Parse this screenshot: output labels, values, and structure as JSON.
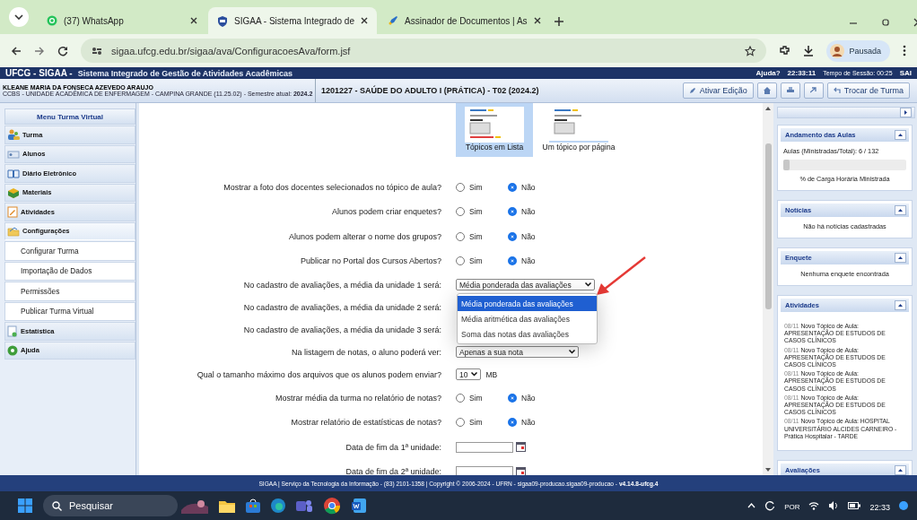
{
  "browser": {
    "tabs": [
      {
        "title": "(37) WhatsApp",
        "selected": false
      },
      {
        "title": "SIGAA - Sistema Integrado de",
        "selected": true
      },
      {
        "title": "Assinador de Documentos | As",
        "selected": false
      }
    ],
    "url": "sigaa.ufcg.edu.br/sigaa/ava/ConfiguracoesAva/form.jsf",
    "profile": "Pausada"
  },
  "app_bar": {
    "title": "UFCG - SIGAA -",
    "subtitle": "Sistema Integrado de Gestão de Atividades Acadêmicas",
    "help": "Ajuda?",
    "clock": "22:33:11",
    "session": "Tempo de Sessão: 00:25",
    "logout": "SAI"
  },
  "header": {
    "user": "KLEANE MARIA DA FONSECA AZEVEDO ARAUJO",
    "unit": "CCBS - UNIDADE ACADÊMICA DE ENFERMAGEM - CAMPINA GRANDE (11.25.02) - Semestre atual: **2024.2**",
    "course": "1201227 - SAÚDE DO ADULTO I (PRÁTICA) - T02 (2024.2)",
    "edit_button": "Ativar Edição",
    "switch_button": "Trocar de Turma"
  },
  "sidebar": {
    "title": "Menu Turma Virtual",
    "items": [
      {
        "label": "Turma"
      },
      {
        "label": "Alunos"
      },
      {
        "label": "Diário Eletrônico"
      },
      {
        "label": "Materiais"
      },
      {
        "label": "Atividades"
      },
      {
        "label": "Configurações",
        "expanded": true,
        "children": [
          {
            "label": "Configurar Turma"
          },
          {
            "label": "Importação de Dados"
          },
          {
            "label": "Permissões"
          },
          {
            "label": "Publicar Turma Virtual"
          }
        ]
      },
      {
        "label": "Estatística"
      },
      {
        "label": "Ajuda"
      }
    ]
  },
  "layout_options": [
    {
      "label": "Tópicos em Lista",
      "selected": true
    },
    {
      "label": "Um tópico por página",
      "selected": false
    }
  ],
  "form": {
    "rows": [
      {
        "kind": "radio",
        "label": "Mostrar a foto dos docentes selecionados no tópico de aula?",
        "options": [
          {
            "label": "Sim",
            "selected": false
          },
          {
            "label": "Não",
            "selected": true
          }
        ]
      },
      {
        "kind": "radio",
        "label": "Alunos podem criar enquetes?",
        "options": [
          {
            "label": "Sim",
            "selected": false
          },
          {
            "label": "Não",
            "selected": true
          }
        ]
      },
      {
        "kind": "radio",
        "label": "Alunos podem alterar o nome dos grupos?",
        "options": [
          {
            "label": "Sim",
            "selected": false
          },
          {
            "label": "Não",
            "selected": true
          }
        ]
      },
      {
        "kind": "radio",
        "label": "Publicar no Portal dos Cursos Abertos?",
        "options": [
          {
            "label": "Sim",
            "selected": false
          },
          {
            "label": "Não",
            "selected": true
          }
        ]
      },
      {
        "kind": "select",
        "label": "No cadastro de avaliações, a média da unidade 1 será:",
        "value": "Média ponderada das avaliações",
        "open": true,
        "options": [
          {
            "label": "Média ponderada das avaliações",
            "selected": true
          },
          {
            "label": "Média aritmética das avaliações",
            "selected": false
          },
          {
            "label": "Soma das notas das avaliações",
            "selected": false
          }
        ]
      },
      {
        "kind": "select",
        "label": "No cadastro de avaliações, a média da unidade 2 será:"
      },
      {
        "kind": "select",
        "label": "No cadastro de avaliações, a média da unidade 3 será:"
      },
      {
        "kind": "select",
        "label": "Na listagem de notas, o aluno poderá ver:",
        "value": "Apenas a sua nota",
        "open": false
      },
      {
        "kind": "select",
        "label": "Qual o tamanho máximo dos arquivos que os alunos podem enviar?",
        "value": "10",
        "open": false,
        "unit": "MB"
      },
      {
        "kind": "radio",
        "label": "Mostrar média da turma no relatório de notas?",
        "options": [
          {
            "label": "Sim",
            "selected": false
          },
          {
            "label": "Não",
            "selected": true
          }
        ]
      },
      {
        "kind": "radio",
        "label": "Mostrar relatório de estatísticas de notas?",
        "options": [
          {
            "label": "Sim",
            "selected": false
          },
          {
            "label": "Não",
            "selected": true
          }
        ]
      },
      {
        "kind": "date",
        "label": "Data de fim da 1ª unidade:"
      },
      {
        "kind": "date",
        "label": "Data de fim da 2ª unidade:"
      }
    ]
  },
  "side_panel": {
    "boxes": [
      {
        "kind": "progress",
        "title": "Andamento das Aulas",
        "summary": "Aulas (Ministradas/Total): 6 / 132",
        "level": 0.05,
        "caption": "% de Carga Horária Ministrada"
      },
      {
        "kind": "message",
        "title": "Notícias",
        "message": "Não há notícias cadastradas"
      },
      {
        "kind": "message",
        "title": "Enquete",
        "message": "Nenhuma enquete encontrada"
      },
      {
        "kind": "feed",
        "title": "Atividades",
        "entries": [
          {
            "date": "08/11",
            "text": "Novo Tópico de Aula: APRESENTAÇÃO DE ESTUDOS DE CASOS CLÍNICOS"
          },
          {
            "date": "08/11",
            "text": "Novo Tópico de Aula: APRESENTAÇÃO DE ESTUDOS DE CASOS CLÍNICOS"
          },
          {
            "date": "08/11",
            "text": "Novo Tópico de Aula: APRESENTAÇÃO DE ESTUDOS DE CASOS CLÍNICOS"
          },
          {
            "date": "08/11",
            "text": "Novo Tópico de Aula: APRESENTAÇÃO DE ESTUDOS DE CASOS CLÍNICOS"
          },
          {
            "date": "08/11",
            "text": "Novo Tópico de Aula: HOSPITAL UNIVERSITÁRIO ALCIDES CARNEIRO - Prática Hospitalar - TARDE"
          }
        ]
      },
      {
        "kind": "collapsed",
        "title": "Avaliações"
      }
    ]
  },
  "footer": {
    "text": "SIGAA | Serviço da Tecnologia da Informação - (83) 2101-1358 | Copyright © 2006-2024 - UFRN - sigaa09-producao.sigaa09-producao - **v4.14.8-ufcg.4**"
  },
  "taskbar": {
    "search": "Pesquisar",
    "language": "POR",
    "time": "22:33"
  }
}
